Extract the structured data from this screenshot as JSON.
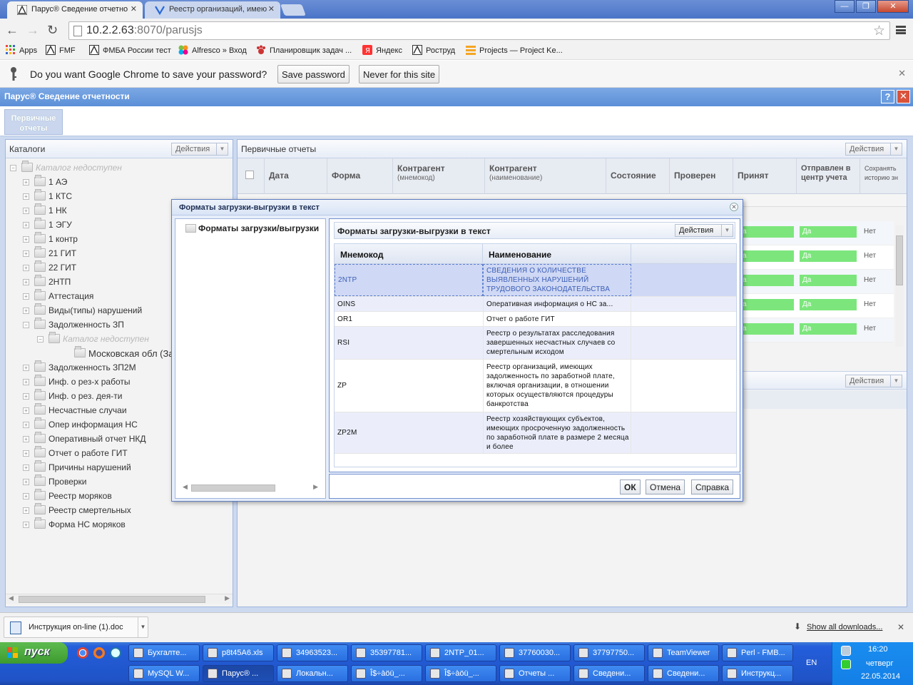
{
  "browser": {
    "tabs": [
      {
        "label": "Парус® Сведение отчетно",
        "active": true
      },
      {
        "label": "Реестр организаций, имею",
        "active": false
      }
    ],
    "url_host": "10.2.2.63",
    "url_rest": ":8070/parusjs",
    "window_buttons": {
      "minimize": "—",
      "maximize": "❐",
      "close": "✕"
    },
    "bookmarks": [
      {
        "label": "Apps",
        "icon": "apps-grid-icon"
      },
      {
        "label": "FMF",
        "icon": "parus-icon"
      },
      {
        "label": "ФМБА России тест",
        "icon": "parus-icon"
      },
      {
        "label": "Alfresco » Вход",
        "icon": "alfresco-icon"
      },
      {
        "label": "Планировщик задач ...",
        "icon": "paw-icon"
      },
      {
        "label": "Яндекс",
        "icon": "yandex-icon"
      },
      {
        "label": "Роструд",
        "icon": "parus-icon"
      },
      {
        "label": "Projects — Project Ke...",
        "icon": "stack-icon"
      }
    ],
    "infobar": {
      "message": "Do you want Google Chrome to save your password?",
      "save_label": "Save password",
      "never_label": "Never for this site"
    }
  },
  "app": {
    "title": "Парус® Сведение отчетности",
    "help": "?",
    "close": "✕",
    "top_tab": "Первичные отчеты",
    "catalogs": {
      "title": "Каталоги",
      "actions": "Действия",
      "root": "Каталог недоступен",
      "items": [
        "1 АЭ",
        "1 КТС",
        "1 НК",
        "1 ЭГУ",
        "1 контр",
        "21 ГИТ",
        "22 ГИТ",
        "2НТП",
        "Аттестация",
        "Виды(типы) нарушений",
        "Задолженность ЗП"
      ],
      "sub_root": "Каталог недоступен",
      "sub_item": "Московская обл (Зад",
      "items_after": [
        "Задолженность ЗП2М",
        "Инф. о рез-х работы",
        "Инф. о рез. дея-ти",
        "Несчастные случаи",
        "Опер информация НС",
        "Оперативный отчет НКД",
        "Отчет о работе ГИТ",
        "Причины нарушений",
        "Проверки",
        "Реестр моряков",
        "Реестр смертельных",
        "Форма НС моряков"
      ]
    },
    "reports": {
      "title": "Первичные отчеты",
      "actions": "Действия",
      "actions2": "Действия",
      "columns": [
        {
          "label": "Дата",
          "sub": ""
        },
        {
          "label": "Форма",
          "sub": ""
        },
        {
          "label": "Контрагент",
          "sub": "(мнемокод)"
        },
        {
          "label": "Контрагент",
          "sub": "(наименование)"
        },
        {
          "label": "Состояние",
          "sub": ""
        },
        {
          "label": "Проверен",
          "sub": ""
        },
        {
          "label": "Принят",
          "sub": ""
        },
        {
          "label": "Отправлен в центр учета",
          "sub": ""
        },
        {
          "label": "Сохранять историю зн",
          "sub": ""
        }
      ],
      "rows": [
        {
          "checked": "а",
          "sent": "Да",
          "history": "Нет"
        },
        {
          "checked": "а",
          "sent": "Да",
          "history": "Нет"
        },
        {
          "checked": "а",
          "sent": "Да",
          "history": "Нет"
        },
        {
          "checked": "а",
          "sent": "Да",
          "history": "Нет"
        },
        {
          "checked": "а",
          "sent": "Да",
          "history": "Нет"
        }
      ]
    }
  },
  "modal": {
    "title": "Форматы загрузки-выгрузки в текст",
    "tree_node": "Форматы загрузки/выгрузки",
    "inner_title": "Форматы загрузки-выгрузки в текст",
    "actions": "Действия",
    "col_mnemo": "Мнемокод",
    "col_name": "Наименование",
    "rows": [
      {
        "code": "2NTP",
        "name": "СВЕДЕНИЯ О КОЛИЧЕСТВЕ ВЫЯВЛЕННЫХ НАРУШЕНИЙ ТРУДОВОГО ЗАКОНОДАТЕЛЬСТВА"
      },
      {
        "code": "OINS",
        "name": "Оперативная информация о НС за..."
      },
      {
        "code": "OR1",
        "name": "Отчет о работе ГИТ"
      },
      {
        "code": "RSI",
        "name": "Реестр о результатах расследования завершенных несчастных случаев со смертельным исходом"
      },
      {
        "code": "ZP",
        "name": "Реестр организаций, имеющих задолженность по заработной плате, включая организации, в отношении которых осуществляются процедуры банкротства"
      },
      {
        "code": "ZP2M",
        "name": "Реестр хозяйствующих субъектов, имеющих просроченную задолженность по заработной плате в размере 2 месяца и более"
      }
    ],
    "ok": "ОК",
    "cancel": "Отмена",
    "help": "Справка"
  },
  "downloads": {
    "file": "Инструкция on-line (1).doc",
    "show_all": "Show all downloads...",
    "close": "✕"
  },
  "taskbar": {
    "start": "пуск",
    "row1": [
      "Бухгалте...",
      "p8t45A6.xls",
      "34963523...",
      "35397781...",
      "2NTP_01...",
      "37760030...",
      "37797750...",
      "TeamViewer",
      "Perl - FMB..."
    ],
    "row2": [
      "MySQL W...",
      "Парус® ...",
      "Локальн...",
      "Î$÷àöü_...",
      "Î$÷àöü_...",
      "Отчеты ...",
      "Сведени...",
      "Сведени...",
      "Инструкц..."
    ],
    "lang": "EN",
    "time": "16:20",
    "day": "четверг",
    "date": "22.05.2014"
  }
}
